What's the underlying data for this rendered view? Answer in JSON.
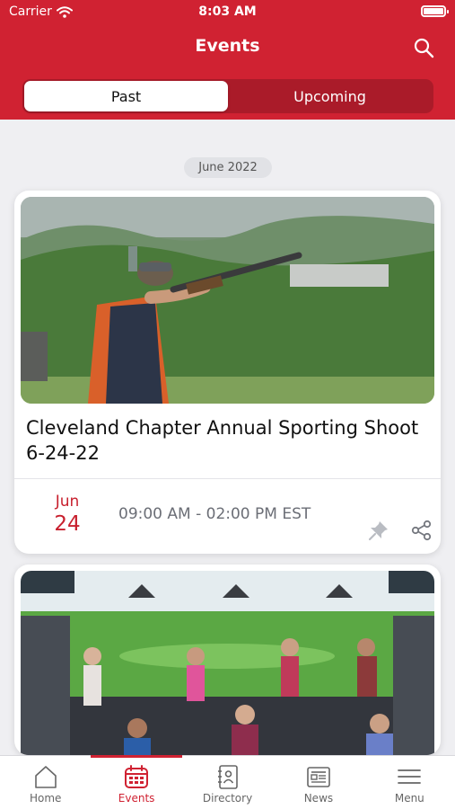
{
  "status_bar": {
    "carrier": "Carrier",
    "time": "8:03 AM"
  },
  "header": {
    "title": "Events"
  },
  "segments": {
    "past": "Past",
    "upcoming": "Upcoming",
    "selected": "Past"
  },
  "section": {
    "label": "June 2022"
  },
  "events": [
    {
      "title": "Cleveland Chapter Annual Sporting Shoot 6-24-22",
      "month": "Jun",
      "day": "24",
      "time_range": "09:00 AM - 02:00 PM EST"
    }
  ],
  "tabbar": {
    "items": [
      {
        "label": "Home",
        "icon": "home-icon"
      },
      {
        "label": "Events",
        "icon": "calendar-icon"
      },
      {
        "label": "Directory",
        "icon": "directory-icon"
      },
      {
        "label": "News",
        "icon": "newspaper-icon"
      },
      {
        "label": "Menu",
        "icon": "menu-icon"
      }
    ],
    "active": "Events"
  },
  "colors": {
    "brand": "#d02232",
    "background": "#efeff2",
    "text_muted": "#6b6e76"
  }
}
